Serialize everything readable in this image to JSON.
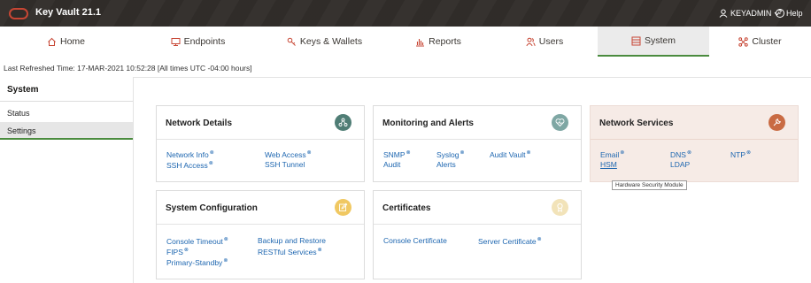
{
  "app": {
    "title": "Key Vault 21.1",
    "user": "KEYADMIN",
    "help": "Help"
  },
  "nav": [
    {
      "label": "Home",
      "icon": "home-icon"
    },
    {
      "label": "Endpoints",
      "icon": "monitor-icon"
    },
    {
      "label": "Keys & Wallets",
      "icon": "key-icon"
    },
    {
      "label": "Reports",
      "icon": "chart-icon"
    },
    {
      "label": "Users",
      "icon": "users-icon"
    },
    {
      "label": "System",
      "icon": "system-icon",
      "active": true
    },
    {
      "label": "Cluster",
      "icon": "cluster-icon"
    }
  ],
  "refresh_text": "Last Refreshed Time: 17-MAR-2021 10:52:28 [All times UTC -04:00 hours]",
  "sidebar": {
    "title": "System",
    "items": [
      {
        "label": "Status"
      },
      {
        "label": "Settings",
        "active": true
      }
    ]
  },
  "cards": {
    "network_details": {
      "title": "Network Details",
      "links": {
        "network_info": "Network Info",
        "web_access": "Web Access",
        "ssh_access": "SSH Access",
        "ssh_tunnel": "SSH Tunnel"
      }
    },
    "monitoring": {
      "title": "Monitoring and Alerts",
      "links": {
        "snmp": "SNMP",
        "syslog": "Syslog",
        "audit_vault": "Audit Vault",
        "audit": "Audit",
        "alerts": "Alerts"
      }
    },
    "network_services": {
      "title": "Network Services",
      "links": {
        "email": "Email",
        "dns": "DNS",
        "ntp": "NTP",
        "hsm": "HSM",
        "ldap": "LDAP"
      }
    },
    "system_config": {
      "title": "System Configuration",
      "links": {
        "console_timeout": "Console Timeout",
        "backup_restore": "Backup and Restore",
        "fips": "FIPS",
        "restful": "RESTful Services",
        "primary_standby": "Primary-Standby"
      }
    },
    "certificates": {
      "title": "Certificates",
      "links": {
        "console_cert": "Console Certificate",
        "server_cert": "Server Certificate"
      }
    }
  },
  "tooltip": "Hardware Security Module",
  "colors": {
    "accent": "#4a8b3e",
    "link": "#1d66b0",
    "brand": "#c74634",
    "topbar": "#312d2a",
    "network_icon": "#4f7d75",
    "monitor_icon": "#7fa7a4",
    "services_icon": "#c96b43",
    "sysconf_icon": "#f0c862",
    "cert_icon": "#f2e3b9"
  }
}
